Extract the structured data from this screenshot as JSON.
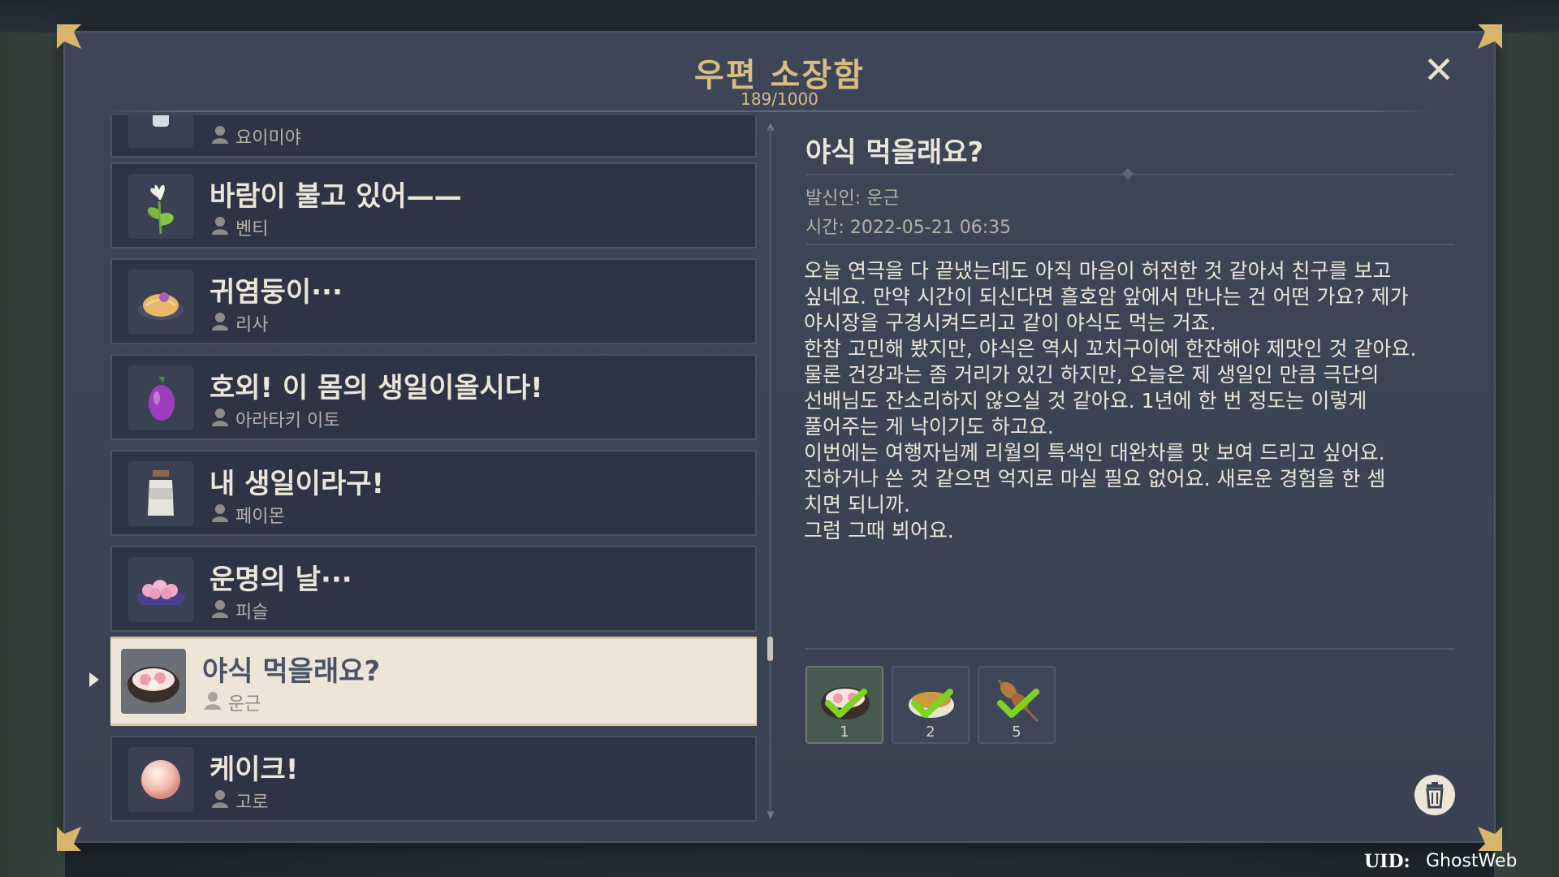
{
  "header": {
    "title": "우편 소장함",
    "count": "189/1000"
  },
  "mail_list": [
    {
      "title": "",
      "sender": "요이미야"
    },
    {
      "title": "바람이 불고 있어——",
      "sender": "벤티"
    },
    {
      "title": "귀염둥이···",
      "sender": "리사"
    },
    {
      "title": "호외! 이 몸의 생일이올시다!",
      "sender": "아라타키 이토"
    },
    {
      "title": "내 생일이라구!",
      "sender": "페이몬"
    },
    {
      "title": "운명의 날···",
      "sender": "피슬"
    },
    {
      "title": "야식 먹을래요?",
      "sender": "운근"
    },
    {
      "title": "케이크!",
      "sender": "고로"
    }
  ],
  "selected_index": 6,
  "detail": {
    "title": "야식 먹을래요?",
    "sender": "발신인: 운근",
    "time": "시간: 2022-05-21 06:35",
    "body": "오늘 연극을 다 끝냈는데도 아직 마음이 허전한 것 같아서 친구를 보고\n싶네요. 만약 시간이 되신다면 흘호암 앞에서 만나는 건 어떤 가요? 제가\n야시장을 구경시켜드리고 같이 야식도 먹는 거죠.\n한참 고민해 봤지만, 야식은 역시 꼬치구이에 한잔해야 제맛인 것 같아요.\n물론 건강과는 좀 거리가 있긴 하지만, 오늘은 제 생일인 만큼 극단의\n선배님도 잔소리하지 않으실 것 같아요. 1년에 한 번 정도는 이렇게\n풀어주는 게 낙이기도 하고요.\n이번에는 여행자님께 리월의 특색인 대완차를 맛 보여 드리고 싶어요.\n진하거나 쓴 것 같으면 억지로 마실 필요 없어요. 새로운 경험을 한 셈\n치면 되니까.\n그럼 그때 뵈어요.",
    "attachments": [
      {
        "quantity": "1",
        "icon": "soup-bowl-icon",
        "claimed": true
      },
      {
        "quantity": "2",
        "icon": "tea-bowl-icon",
        "claimed": true
      },
      {
        "quantity": "5",
        "icon": "skewer-icon",
        "claimed": true
      }
    ]
  },
  "footer": {
    "uid_label": "UID:",
    "uid_value": "GhostWeb"
  },
  "colors": {
    "accent_gold": "#d8bd83",
    "panel": "#3b4355",
    "item": "#2e3446",
    "selected_item": "#ece5d8",
    "check_green": "#7ed321"
  }
}
